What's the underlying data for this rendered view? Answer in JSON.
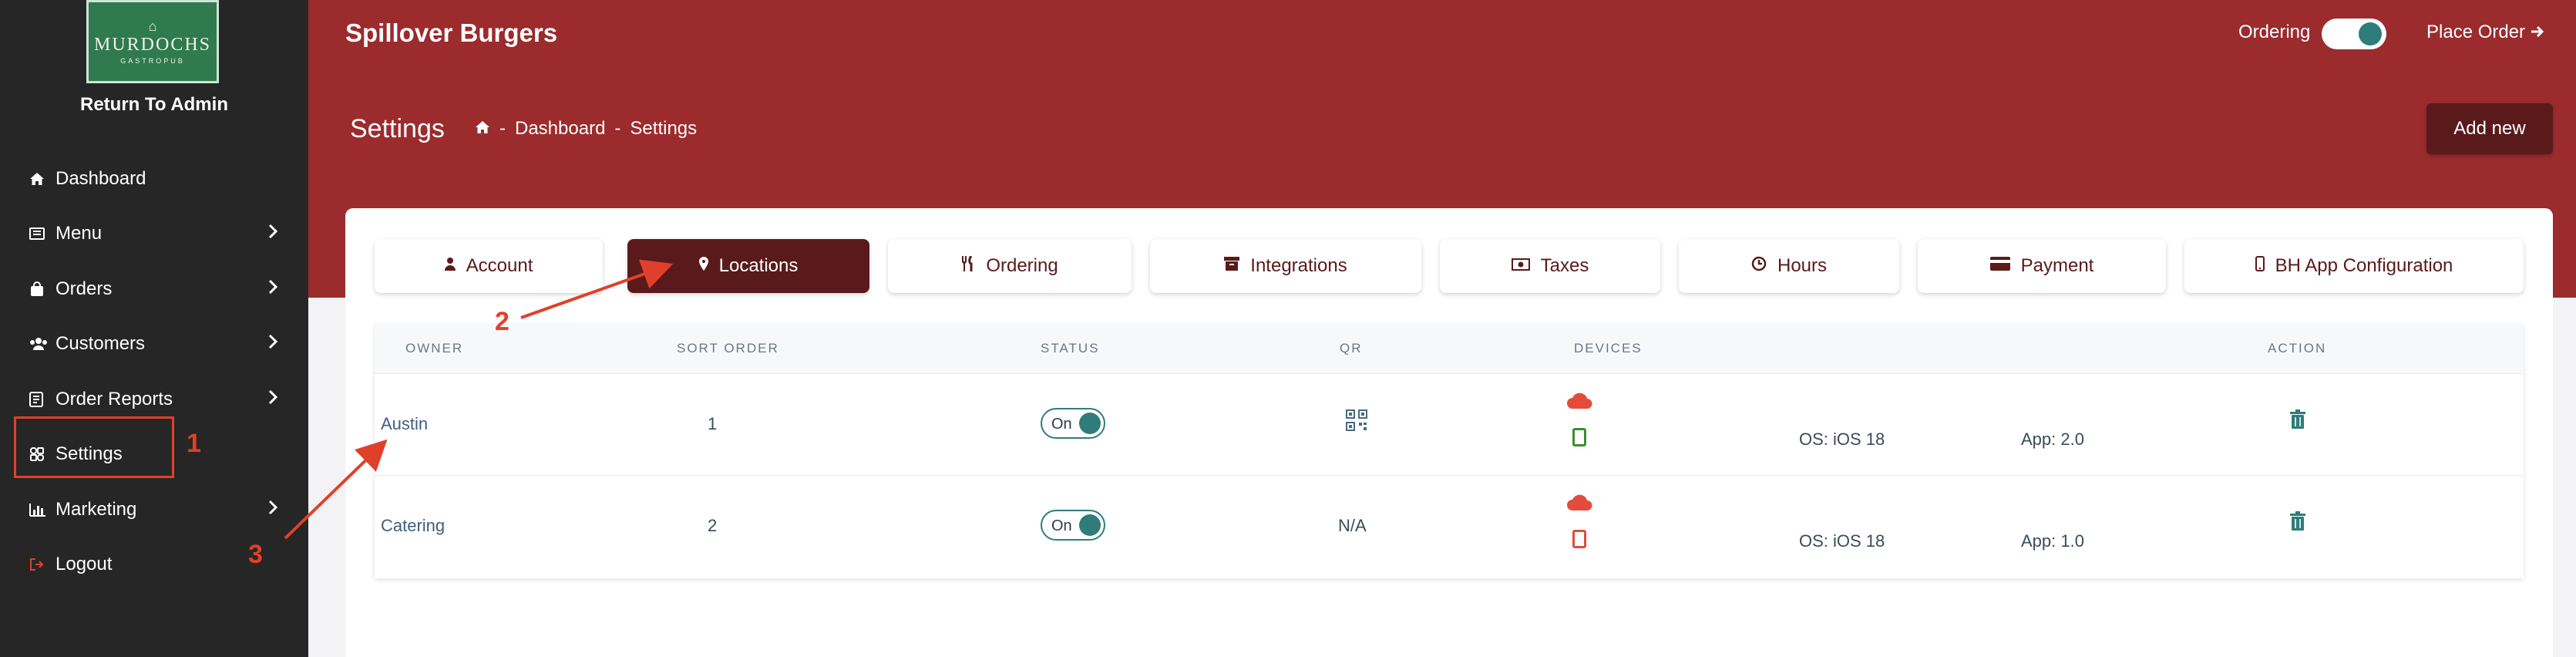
{
  "sidebar": {
    "logo": {
      "line1": "MURDOCHS",
      "line2": "GASTROPUB"
    },
    "return_to_admin": "Return To Admin",
    "items": [
      {
        "label": "Dashboard",
        "icon": "home-icon",
        "has_chevron": false
      },
      {
        "label": "Menu",
        "icon": "book-icon",
        "has_chevron": true
      },
      {
        "label": "Orders",
        "icon": "shopping-bag-icon",
        "has_chevron": true
      },
      {
        "label": "Customers",
        "icon": "users-icon",
        "has_chevron": true
      },
      {
        "label": "Order Reports",
        "icon": "report-icon",
        "has_chevron": true
      },
      {
        "label": "Settings",
        "icon": "settings-icon",
        "has_chevron": false
      },
      {
        "label": "Marketing",
        "icon": "bar-chart-icon",
        "has_chevron": true
      },
      {
        "label": "Logout",
        "icon": "logout-icon",
        "has_chevron": false
      }
    ]
  },
  "header": {
    "brand": "Spillover Burgers",
    "ordering_label": "Ordering",
    "ordering_on": true,
    "place_order": "Place Order",
    "page_title": "Settings",
    "breadcrumb": [
      "Dashboard",
      "Settings"
    ],
    "add_new": "Add new"
  },
  "tabs": [
    {
      "label": "Account",
      "icon": "user-icon",
      "active": false
    },
    {
      "label": "Locations",
      "icon": "map-pin-icon",
      "active": true
    },
    {
      "label": "Ordering",
      "icon": "utensils-icon",
      "active": false
    },
    {
      "label": "Integrations",
      "icon": "archive-icon",
      "active": false
    },
    {
      "label": "Taxes",
      "icon": "money-icon",
      "active": false
    },
    {
      "label": "Hours",
      "icon": "clock-icon",
      "active": false
    },
    {
      "label": "Payment",
      "icon": "credit-card-icon",
      "active": false
    },
    {
      "label": "BH App Configuration",
      "icon": "mobile-icon",
      "active": false
    }
  ],
  "table": {
    "headers": [
      "OWNER",
      "SORT ORDER",
      "STATUS",
      "QR",
      "DEVICES",
      "ACTION"
    ],
    "rows": [
      {
        "owner": "Austin",
        "sort_order": "1",
        "status": "On",
        "qr": "qr-code-icon",
        "device_color": "#3a8f2f",
        "os": "OS: iOS 18",
        "app": "App: 2.0"
      },
      {
        "owner": "Catering",
        "sort_order": "2",
        "status": "On",
        "qr": "N/A",
        "device_color": "#e34c3c",
        "os": "OS: iOS 18",
        "app": "App: 1.0"
      }
    ]
  },
  "annotations": [
    "1",
    "2",
    "3"
  ],
  "colors": {
    "header_bg": "#9b2b2d",
    "sidebar_bg": "#262626",
    "accent_dark": "#5a1a1b",
    "toggle_teal": "#2e7d7a",
    "annotation_red": "#e0402b"
  }
}
